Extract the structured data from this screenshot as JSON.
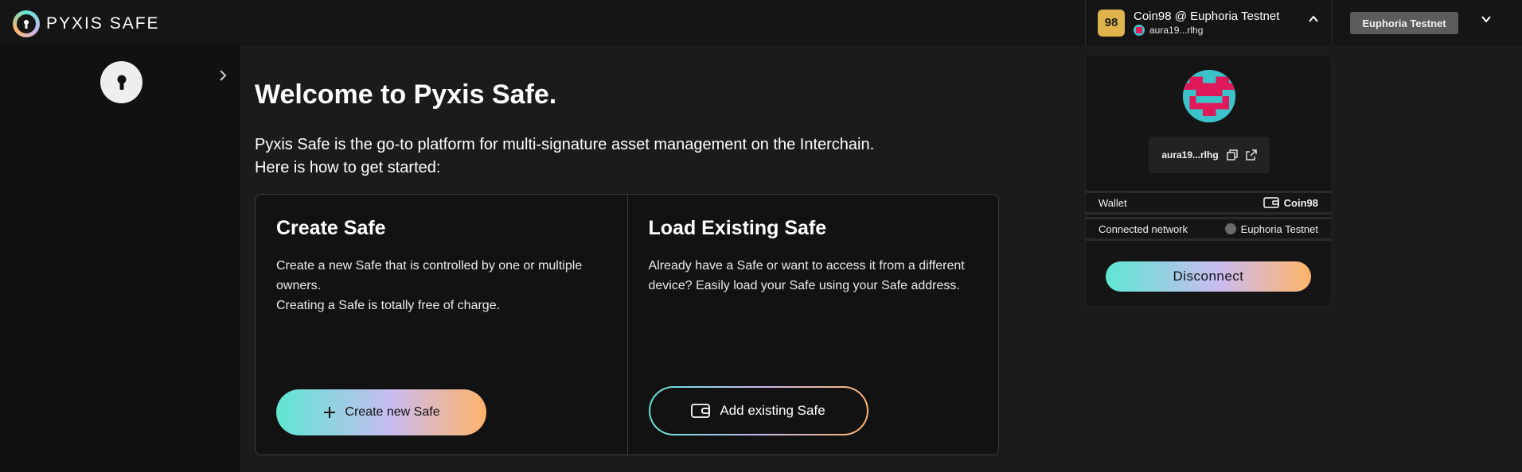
{
  "header": {
    "app_name": "PYXIS SAFE",
    "account_title": "Coin98 @ Euphoria Testnet",
    "account_address": "aura19...rlhg",
    "wallet_badge": "98",
    "network_button": "Euphoria Testnet"
  },
  "main": {
    "title": "Welcome to Pyxis Safe.",
    "desc_line1": "Pyxis Safe is the go-to platform for multi-signature asset management on the Interchain.",
    "desc_line2": "Here is how to get started:",
    "create": {
      "title": "Create Safe",
      "desc_line1": "Create a new Safe that is controlled by one or multiple owners.",
      "desc_line2": "Creating a Safe is totally free of charge.",
      "button": "Create new Safe"
    },
    "load": {
      "title": "Load Existing Safe",
      "desc": "Already have a Safe or want to access it from a different device? Easily load your Safe using your Safe address.",
      "button": "Add existing Safe"
    }
  },
  "panel": {
    "address": "aura19...rlhg",
    "wallet_label": "Wallet",
    "wallet_value": "Coin98",
    "network_label": "Connected network",
    "network_value": "Euphoria Testnet",
    "disconnect": "Disconnect"
  },
  "colors": {
    "accent_gradient_start": "#5ee7d2",
    "accent_gradient_mid": "#c9bbf0",
    "accent_gradient_end": "#ffb46a",
    "wallet_badge": "#e0b44c"
  }
}
